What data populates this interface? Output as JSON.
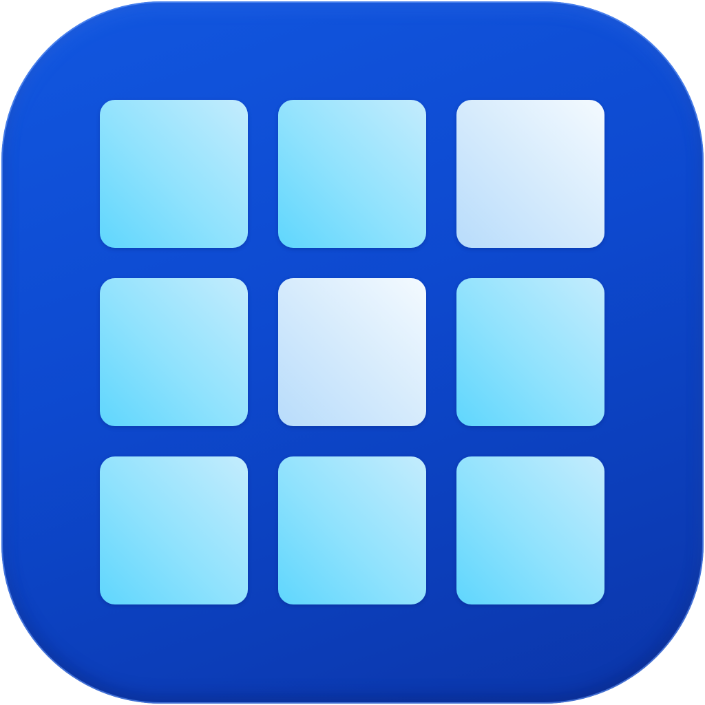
{
  "app_icon": {
    "name": "grid-app-icon",
    "background_color": "#0d49cf",
    "grid": {
      "rows": 3,
      "columns": 3,
      "tiles": [
        {
          "style": "blue",
          "color": "#8fe2fd"
        },
        {
          "style": "blue",
          "color": "#8fe2fd"
        },
        {
          "style": "pale",
          "color": "#d6ebfc"
        },
        {
          "style": "blue",
          "color": "#8fe2fd"
        },
        {
          "style": "pale",
          "color": "#d6ebfc"
        },
        {
          "style": "blue",
          "color": "#8fe2fd"
        },
        {
          "style": "blue",
          "color": "#8fe2fd"
        },
        {
          "style": "blue",
          "color": "#8fe2fd"
        },
        {
          "style": "blue",
          "color": "#8fe2fd"
        }
      ]
    }
  }
}
